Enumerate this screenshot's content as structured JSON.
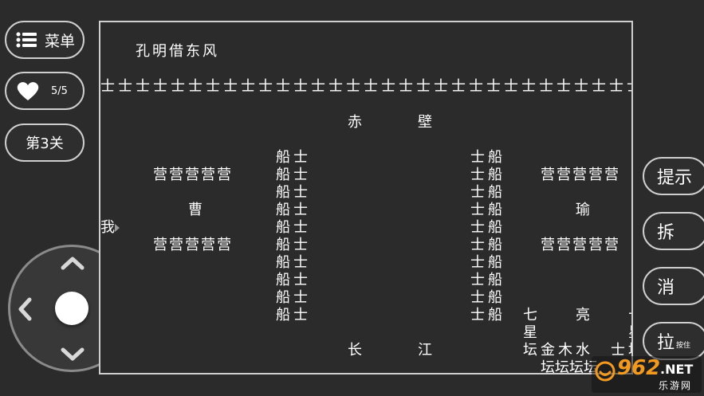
{
  "sidebar": {
    "menu_label": "菜单",
    "lives": "5/5",
    "level": "第3关"
  },
  "board": {
    "title": "孔明借东风",
    "top_row": "士士士士士士士士士士士士士士士士士士士士士士士士士士士士士士士",
    "chibi_1": "赤",
    "chibi_2": "壁",
    "cao": "曹",
    "yu": "瑜",
    "ying_row": "营营营营营",
    "ying_row_right": "营营营营营",
    "left_ships": [
      "船士",
      "船士",
      "船士",
      "船士",
      "船士",
      "船士",
      "船士",
      "船士",
      "船士",
      "船士"
    ],
    "right_ships": [
      "士船",
      "士船",
      "士船",
      "士船",
      "士船",
      "士船",
      "士船",
      "士船",
      "士船",
      "士船"
    ],
    "player": "我",
    "qi": "七",
    "liang": "亮",
    "xing": "星",
    "tan": "坛",
    "jin": "金",
    "mu": "木",
    "shui": "水",
    "shi": "士",
    "tan_row": "坛坛坛坛",
    "chang": "长",
    "jiang": "江",
    "edge_top": "十",
    "edge_mid": "星",
    "edge_bot": "坛"
  },
  "actions": {
    "hint": "提示",
    "split": "拆",
    "eliminate": "消",
    "pull": "拉",
    "pull_hold": "按住"
  },
  "watermark": {
    "number": "962",
    "suffix": ".NET",
    "sub": "乐游网"
  },
  "colors": {
    "background": "#2b2b2b",
    "border": "#cfcfcf",
    "watermark_orange": "#f39a1e"
  }
}
